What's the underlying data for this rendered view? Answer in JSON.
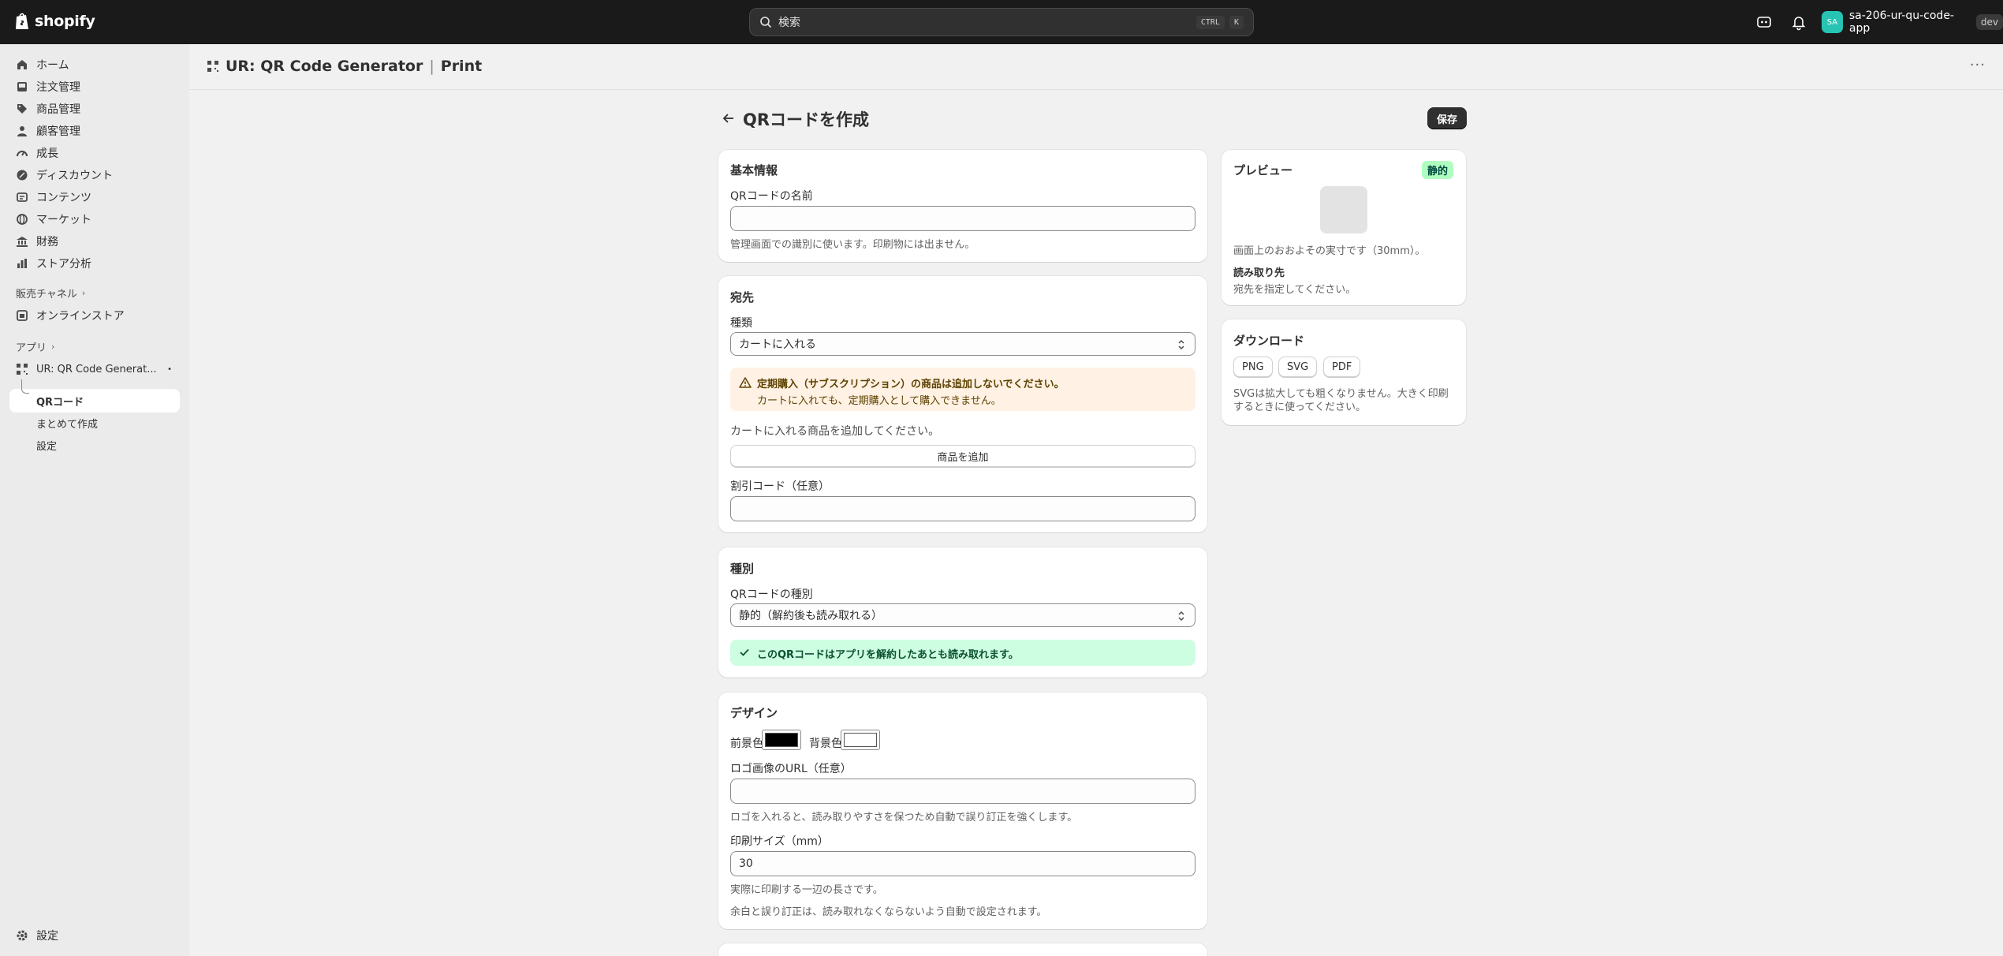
{
  "topbar": {
    "logo": "shopify",
    "search_placeholder": "検索",
    "shortcut_ctrl": "CTRL",
    "shortcut_key": "K",
    "store_avatar": "SA",
    "store_name": "sa-206-ur-qu-code-app",
    "store_badge": "dev"
  },
  "sidebar": {
    "items": [
      {
        "label": "ホーム",
        "icon": "home-icon"
      },
      {
        "label": "注文管理",
        "icon": "inbox-icon"
      },
      {
        "label": "商品管理",
        "icon": "tag-icon"
      },
      {
        "label": "顧客管理",
        "icon": "person-icon"
      },
      {
        "label": "成長",
        "icon": "gauge-icon"
      },
      {
        "label": "ディスカウント",
        "icon": "discount-icon"
      },
      {
        "label": "コンテンツ",
        "icon": "content-icon"
      },
      {
        "label": "マーケット",
        "icon": "globe-icon"
      },
      {
        "label": "財務",
        "icon": "bank-icon"
      },
      {
        "label": "ストア分析",
        "icon": "chart-icon"
      }
    ],
    "sales_channels_label": "販売チャネル",
    "online_store_label": "オンラインストア",
    "apps_label": "アプリ",
    "app_name": "UR: QR Code Generat...",
    "app_subitems": [
      "QRコード",
      "まとめて作成",
      "設定"
    ],
    "settings_label": "設定"
  },
  "app_header": {
    "title": "UR: QR Code Generator",
    "separator": "|",
    "subtitle": "Print"
  },
  "page": {
    "title": "QRコードを作成",
    "save_label": "保存"
  },
  "basic": {
    "title": "基本情報",
    "name_label": "QRコードの名前",
    "name_value": "",
    "name_help": "管理画面での識別に使います。印刷物には出ません。"
  },
  "destination": {
    "title": "宛先",
    "type_label": "種類",
    "type_value": "カートに入れる",
    "warning_title": "定期購入（サブスクリプション）の商品は追加しないでください。",
    "warning_body": "カートに入れても、定期購入として購入できません。",
    "add_help": "カートに入れる商品を追加してください。",
    "add_button": "商品を追加",
    "discount_label": "割引コード（任意）",
    "discount_value": ""
  },
  "kind": {
    "title": "種別",
    "kind_label": "QRコードの種別",
    "kind_value": "静的（解約後も読み取れる）",
    "success_text": "このQRコードはアプリを解約したあとも読み取れます。"
  },
  "design": {
    "title": "デザイン",
    "fg_label": "前景色",
    "fg_color": "#000000",
    "bg_label": "背景色",
    "bg_color": "#ffffff",
    "logo_label": "ロゴ画像のURL（任意）",
    "logo_value": "",
    "logo_help": "ロゴを入れると、読み取りやすさを保つため自動で誤り訂正を強くします。",
    "size_label": "印刷サイズ（mm）",
    "size_value": "30",
    "size_help1": "実際に印刷する一辺の長さです。",
    "size_help2": "余白と誤り訂正は、読み取れなくならないよう自動で設定されます。"
  },
  "preview": {
    "title": "プレビュー",
    "badge": "静的",
    "size_note": "画面上のおおよその実寸です（30mm）。",
    "read_label": "読み取り先",
    "read_value": "宛先を指定してください。"
  },
  "download": {
    "title": "ダウンロード",
    "buttons": [
      "PNG",
      "SVG",
      "PDF"
    ],
    "note": "SVGは拡大しても粗くなりません。大きく印刷するときに使ってください。"
  },
  "colors": {
    "topbar": "#1a1a1a",
    "warning_bg": "#fff1e3",
    "warning_text": "#5e4200",
    "success_bg": "#cdfee1",
    "success_text": "#0c5132",
    "badge_bg": "#affebf",
    "badge_text": "#014b40"
  }
}
